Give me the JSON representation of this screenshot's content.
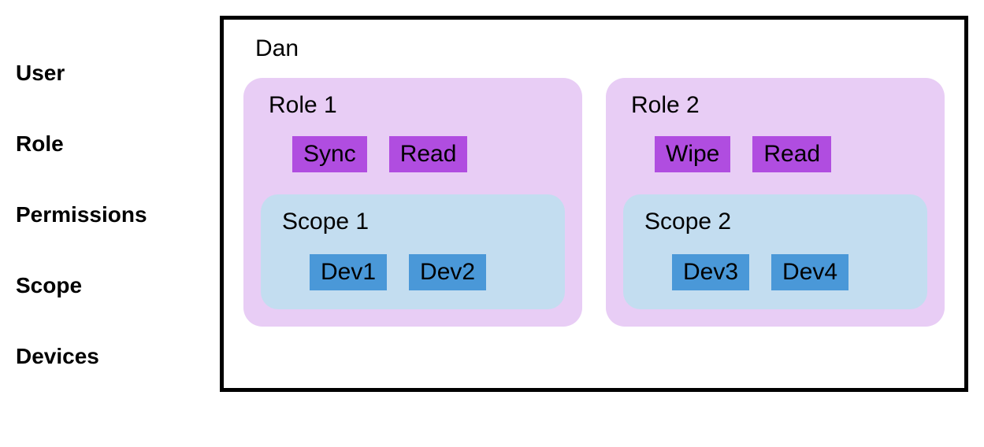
{
  "labels": {
    "user": "User",
    "role": "Role",
    "permissions": "Permissions",
    "scope": "Scope",
    "devices": "Devices"
  },
  "user": {
    "name": "Dan"
  },
  "roles": [
    {
      "title": "Role 1",
      "permissions": [
        "Sync",
        "Read"
      ],
      "scope": {
        "title": "Scope 1",
        "devices": [
          "Dev1",
          "Dev2"
        ]
      }
    },
    {
      "title": "Role 2",
      "permissions": [
        "Wipe",
        "Read"
      ],
      "scope": {
        "title": "Scope 2",
        "devices": [
          "Dev3",
          "Dev4"
        ]
      }
    }
  ]
}
